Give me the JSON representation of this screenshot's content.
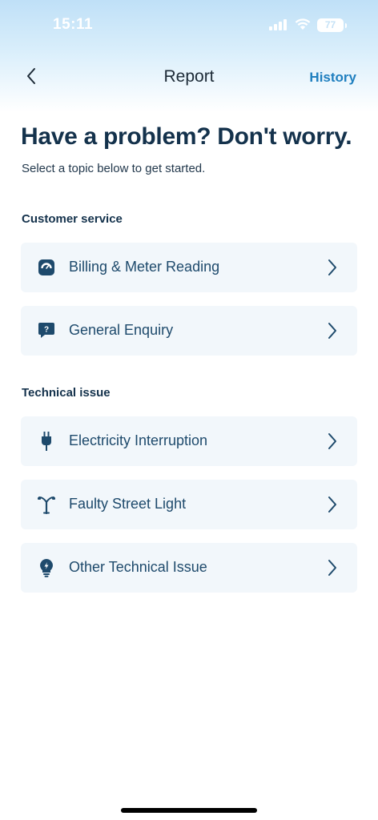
{
  "status_bar": {
    "time": "15:11",
    "battery": "77"
  },
  "nav": {
    "title": "Report",
    "history_label": "History"
  },
  "hero": {
    "heading": "Have a problem? Don't worry.",
    "subheading": "Select a topic below to get started."
  },
  "sections": [
    {
      "label": "Customer service",
      "items": [
        {
          "label": "Billing & Meter Reading",
          "icon": "meter-icon"
        },
        {
          "label": "General Enquiry",
          "icon": "question-bubble-icon"
        }
      ]
    },
    {
      "label": "Technical issue",
      "items": [
        {
          "label": "Electricity Interruption",
          "icon": "plug-icon"
        },
        {
          "label": "Faulty Street Light",
          "icon": "street-light-icon"
        },
        {
          "label": "Other Technical Issue",
          "icon": "lightbulb-icon"
        }
      ]
    }
  ],
  "colors": {
    "primary_text": "#14324c",
    "item_text": "#1e4a6c",
    "link": "#1f7fbf",
    "item_bg": "#f2f7fb",
    "icon": "#1e4a6c"
  }
}
